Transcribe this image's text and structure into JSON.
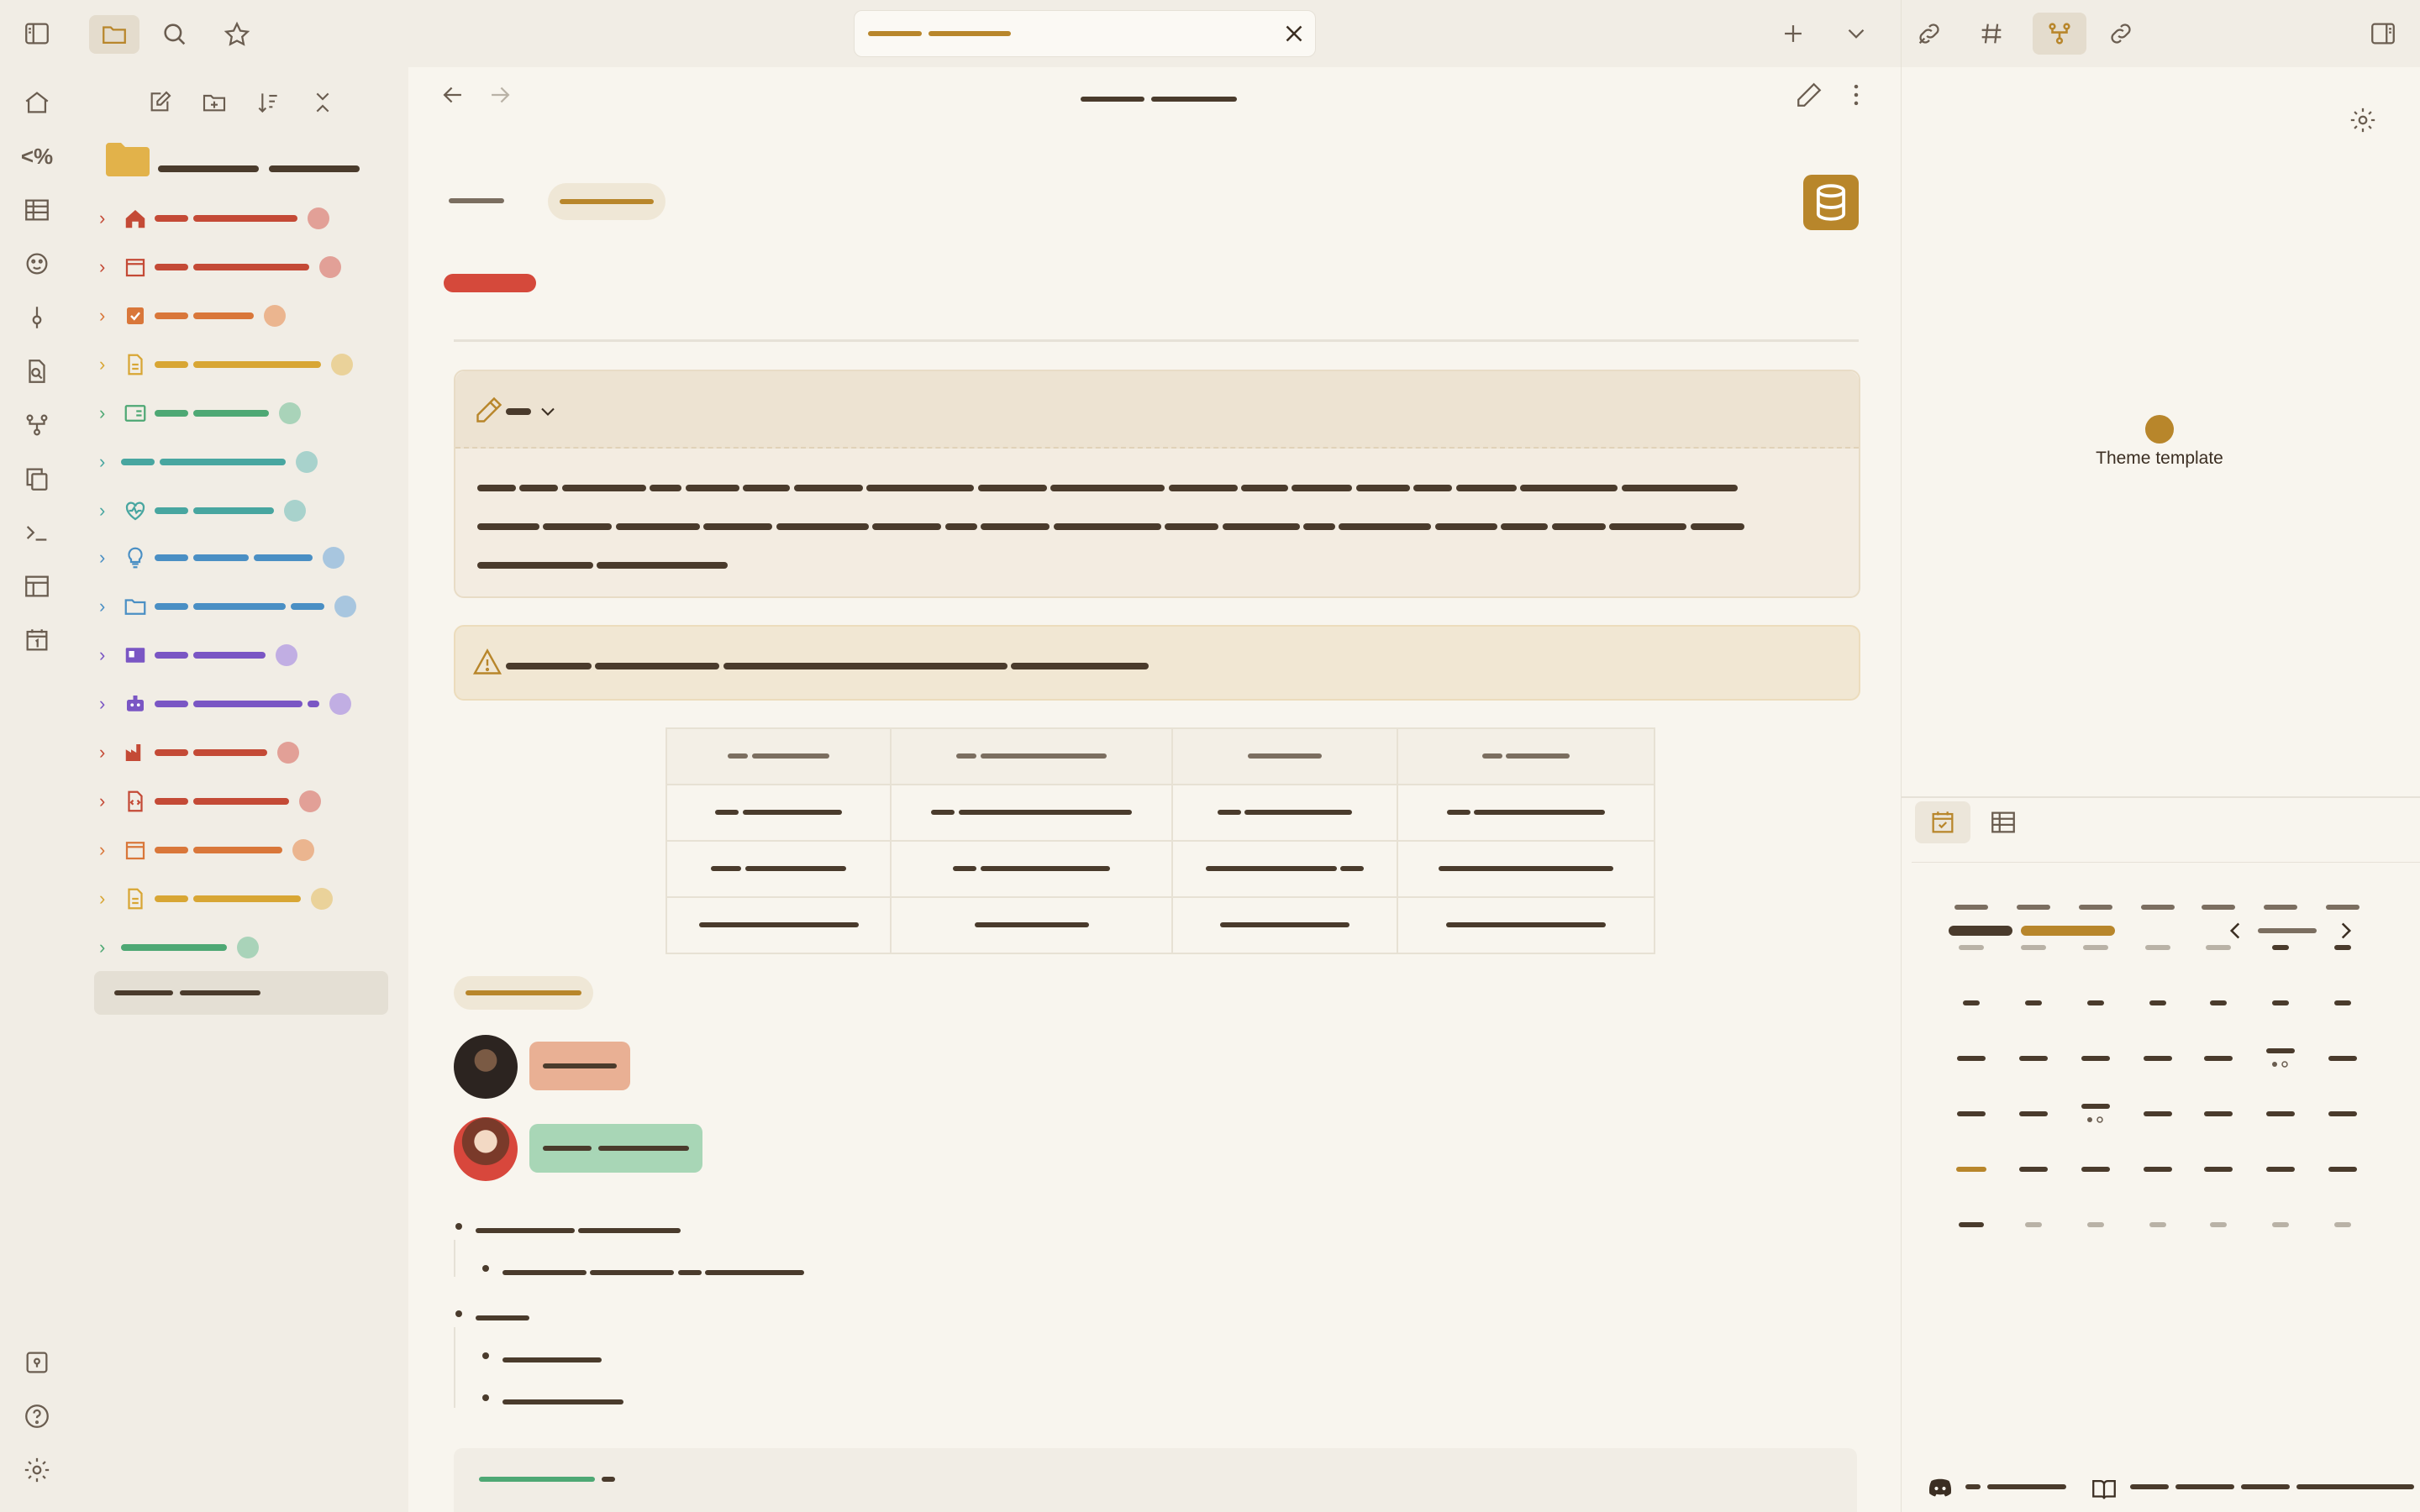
{
  "ribbon": {
    "icons": [
      "home-icon",
      "templater-icon",
      "table-icon",
      "face-icon",
      "tag-icon",
      "search-file-icon",
      "graph-icon",
      "copy-icon",
      "terminal-icon",
      "layout-icon",
      "calendar-day-icon",
      "vault-icon",
      "help-icon",
      "settings-icon"
    ]
  },
  "sidebar": {
    "top_buttons": [
      "folder-icon",
      "search-icon",
      "star-icon"
    ],
    "nav_buttons": [
      "new-note-icon",
      "new-folder-icon",
      "sort-icon",
      "collapse-icon"
    ],
    "vault_name": "",
    "items": [
      {
        "icon": "home-icon",
        "color": "#c44a36",
        "dot": "#e2a097"
      },
      {
        "icon": "calendar-icon",
        "color": "#c44a36",
        "dot": "#e2a097"
      },
      {
        "icon": "checkbox-icon",
        "color": "#d9773a",
        "dot": "#ebb58f"
      },
      {
        "icon": "file-icon",
        "color": "#d8a634",
        "dot": "#ead29a"
      },
      {
        "icon": "id-card-icon",
        "color": "#4ea874",
        "dot": "#a9d3b9"
      },
      {
        "icon": "none",
        "color": "#48a6a0",
        "dot": "#a8d2cc"
      },
      {
        "icon": "heart-pulse-icon",
        "color": "#48a6a0",
        "dot": "#a8d2cc"
      },
      {
        "icon": "lightbulb-icon",
        "color": "#4a8fc4",
        "dot": "#a8c6df"
      },
      {
        "icon": "folder-icon",
        "color": "#4a8fc4",
        "dot": "#a8c6df"
      },
      {
        "icon": "id-card-icon",
        "color": "#7a56c4",
        "dot": "#c1aee3"
      },
      {
        "icon": "robot-icon",
        "color": "#7a56c4",
        "dot": "#c1aee3"
      },
      {
        "icon": "factory-icon",
        "color": "#c44a36",
        "dot": "#e2a097"
      },
      {
        "icon": "file-code-icon",
        "color": "#c44a36",
        "dot": "#e2a097"
      },
      {
        "icon": "calendar-icon",
        "color": "#d9773a",
        "dot": "#ebb58f"
      },
      {
        "icon": "file-icon",
        "color": "#d8a634",
        "dot": "#ead29a"
      },
      {
        "icon": "none",
        "color": "#4ea874",
        "dot": "#a9d3b9"
      }
    ]
  },
  "tabbar": {
    "active_tab_title": "",
    "new_tab_label": "+",
    "right_icons": [
      "backlinks-icon",
      "tag-hash-icon",
      "graph-icon",
      "outgoing-links-icon"
    ]
  },
  "main": {
    "breadcrumb": "",
    "callout_type": ""
  },
  "rpanel": {
    "graph_node_label": "Theme template",
    "calendar_month": "",
    "colors": {
      "accent": "#b8862b",
      "text": "#3b2e22",
      "muted": "#b9b2a6"
    }
  },
  "footer": {
    "discord_icon": "discord-icon",
    "book_icon": "book-icon"
  }
}
